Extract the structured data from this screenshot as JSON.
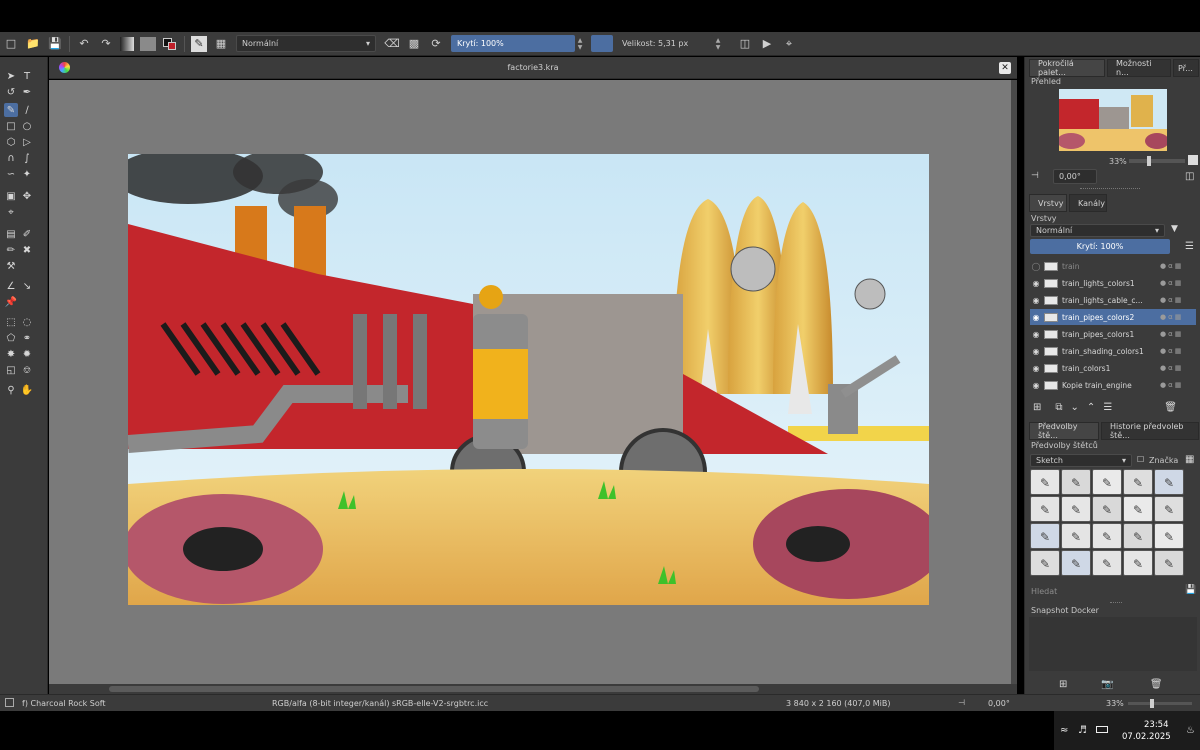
{
  "toolbar": {
    "blend_mode": "Normální",
    "opacity_label": "Krytí: 100%",
    "size_label": "Velikost: 5,31 px"
  },
  "document": {
    "title": "factorie3.kra"
  },
  "docker": {
    "tabs": [
      "Pokročilá palet...",
      "Možnosti n...",
      "Př..."
    ],
    "overview_label": "Přehled",
    "zoom": "33%",
    "rotation": "0,00°",
    "layer_tabs": [
      "Vrstvy",
      "Kanály"
    ],
    "layers_label": "Vrstvy",
    "layer_blend": "Normální",
    "layer_opacity": "Krytí:  100%",
    "layers": [
      {
        "name": "train",
        "selected": false,
        "visible": false
      },
      {
        "name": "train_lights_colors1",
        "selected": false,
        "visible": true
      },
      {
        "name": "train_lights_cable_c...",
        "selected": false,
        "visible": true
      },
      {
        "name": "train_pipes_colors2",
        "selected": true,
        "visible": true
      },
      {
        "name": "train_pipes_colors1",
        "selected": false,
        "visible": true
      },
      {
        "name": "train_shading_colors1",
        "selected": false,
        "visible": true
      },
      {
        "name": "train_colors1",
        "selected": false,
        "visible": true
      },
      {
        "name": "Kopie train_engine",
        "selected": false,
        "visible": true
      }
    ],
    "preset_tabs": [
      "Předvolby ště...",
      "Historie předvoleb ště..."
    ],
    "presets_label": "Předvolby štětců",
    "preset_filter": "Sketch",
    "preset_tag": "Značka",
    "search_placeholder": "Hledat",
    "snapshot_label": "Snapshot Docker"
  },
  "status": {
    "brush_name": "f) Charcoal Rock Soft",
    "color_info": "RGB/alfa (8-bit integer/kanál)  sRGB-elle-V2-srgbtrc.icc",
    "dimensions": "3 840 x 2 160 (407,0 MiB)",
    "rotation": "0,00°",
    "zoom": "33%"
  },
  "clock": {
    "time": "23:54",
    "date": "07.02.2025"
  }
}
